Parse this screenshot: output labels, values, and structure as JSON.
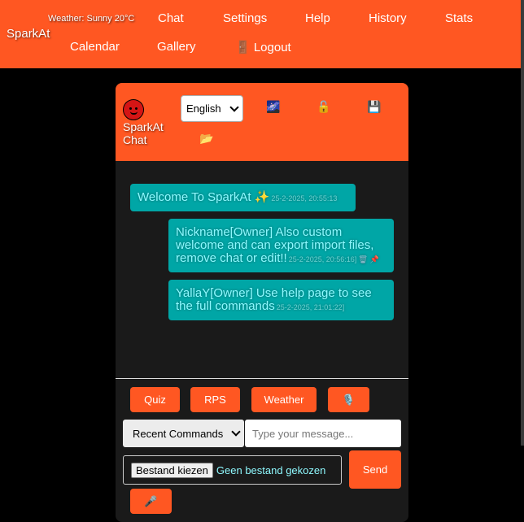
{
  "nav": {
    "brand": "SparkAt",
    "weather": "Weather: Sunny 20°C",
    "chat": "Chat",
    "settings": "Settings",
    "help": "Help",
    "history": "History",
    "stats": "Stats",
    "calendar": "Calendar",
    "gallery": "Gallery",
    "logout": "🚪 Logout"
  },
  "header": {
    "title": "SparkAt Chat",
    "language": "English",
    "icons": {
      "theme": "🌌",
      "lock": "🔓",
      "save": "💾",
      "open": "📂"
    }
  },
  "messages": [
    {
      "text": "Welcome To SparkAt ✨",
      "timestamp": "25-2-2025, 20:55:13"
    },
    {
      "text": "Nickname[Owner] Also custom welcome and can export import files, remove chat or edit!!",
      "timestamp": "25-2-2025, 20:56:16] 🗑️ 📌"
    },
    {
      "text": "YallaY[Owner] Use help page to see the full commands",
      "timestamp": "25-2-2025, 21:01:22]"
    }
  ],
  "controls": {
    "quiz": "Quiz",
    "rps": "RPS",
    "weather": "Weather",
    "mic_top": "🎙️",
    "recent_commands": "Recent Commands",
    "message_placeholder": "Type your message...",
    "file_choose": "Bestand kiezen",
    "file_none": "Geen bestand gekozen",
    "send": "Send",
    "mic_bottom": "🎤"
  },
  "colors": {
    "accent": "#ff5722",
    "bubble": "#00a6a6",
    "bubble_text": "#8ff9ff",
    "card_bg": "#1a1a1a"
  }
}
